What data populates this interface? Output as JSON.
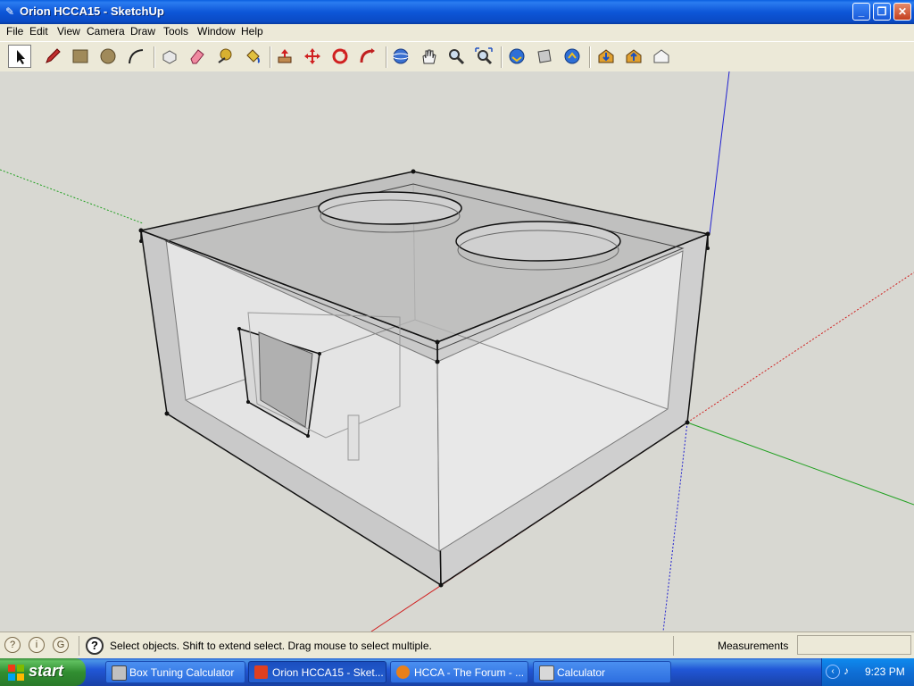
{
  "window": {
    "title": "Orion HCCA15 - SketchUp",
    "minimize_label": "_",
    "maximize_label": "❐",
    "close_label": "✕"
  },
  "menu": [
    "File",
    "Edit",
    "View",
    "Camera",
    "Draw",
    "Tools",
    "Window",
    "Help"
  ],
  "toolbar": {
    "tools": [
      "select",
      "pencil",
      "rectangle",
      "circle",
      "arc",
      "make-component",
      "eraser",
      "tape-measure",
      "paint-bucket",
      "push-pull",
      "move",
      "rotate",
      "follow-me",
      "orbit",
      "pan",
      "zoom",
      "zoom-extents",
      "get-models",
      "share-model",
      "share-component",
      "get-photo-texture",
      "place-model",
      "export-model"
    ],
    "active_tool": "select"
  },
  "colors": {
    "axis_red": "#d02020",
    "axis_green": "#20a020",
    "axis_blue": "#2020d0",
    "viewport_bg": "#d8d8d2",
    "model_face": "#c9c9c9"
  },
  "statusbar": {
    "text": "Select objects. Shift to extend select. Drag mouse to select multiple.",
    "measurements_label": "Measurements",
    "measurements_value": ""
  },
  "taskbar": {
    "start_label": "start",
    "tasks": [
      {
        "label": "Box Tuning Calculator",
        "icon": "app-icon",
        "active": false
      },
      {
        "label": "Orion HCCA15 - Sket...",
        "icon": "sketchup-icon",
        "active": true
      },
      {
        "label": "HCCA - The Forum - ...",
        "icon": "firefox-icon",
        "active": false
      },
      {
        "label": "Calculator",
        "icon": "calculator-icon",
        "active": false
      }
    ],
    "clock": "9:23 PM"
  }
}
